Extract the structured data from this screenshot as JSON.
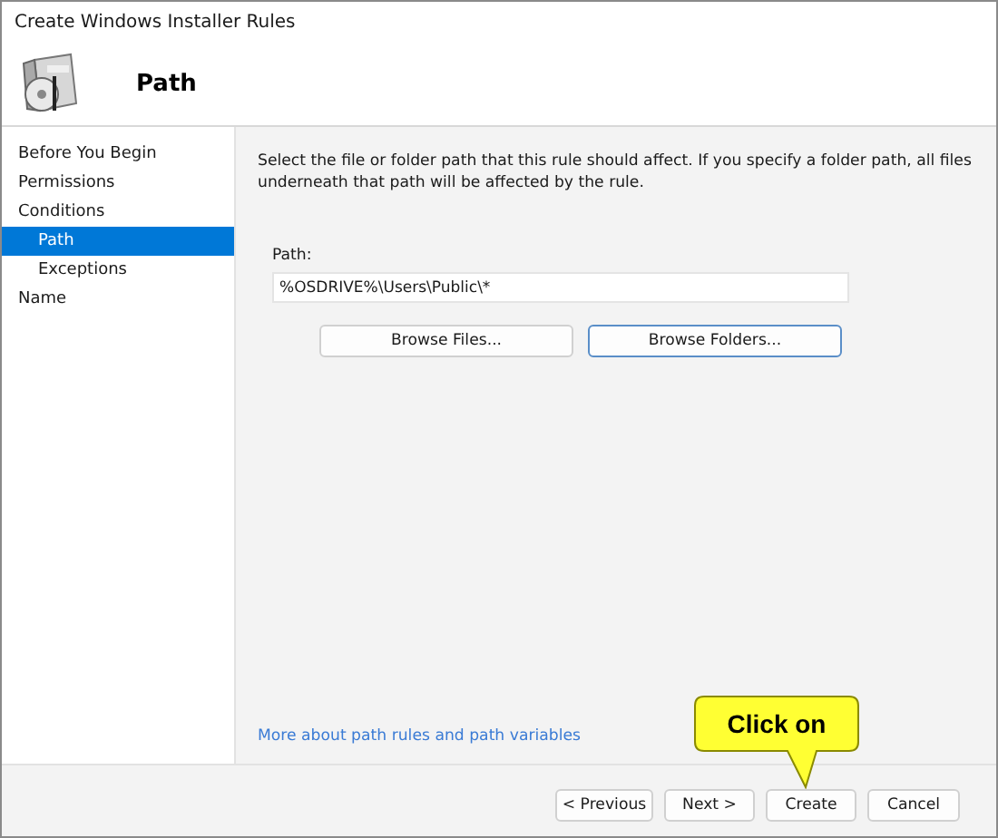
{
  "window": {
    "title": "Create Windows Installer Rules"
  },
  "header": {
    "title": "Path"
  },
  "sidebar": {
    "items": [
      {
        "label": "Before You Begin",
        "selected": false
      },
      {
        "label": "Permissions",
        "selected": false
      },
      {
        "label": "Conditions",
        "selected": false,
        "children": [
          {
            "label": "Path",
            "selected": true
          },
          {
            "label": "Exceptions",
            "selected": false
          }
        ]
      },
      {
        "label": "Name",
        "selected": false
      }
    ]
  },
  "description": "Select the file or folder path that this rule should affect. If you specify a folder path, all files underneath that path will be affected by the rule.",
  "path_field": {
    "label": "Path:",
    "value": "%OSDRIVE%\\Users\\Public\\*"
  },
  "browse_buttons": [
    {
      "label": "Browse Files...",
      "focused": false
    },
    {
      "label": "Browse Folders...",
      "focused": true
    }
  ],
  "help_link": "More about path rules and path variables",
  "footer_buttons": [
    "< Previous",
    "Next >",
    "Create",
    "Cancel"
  ],
  "callout": {
    "text": "Click on"
  }
}
